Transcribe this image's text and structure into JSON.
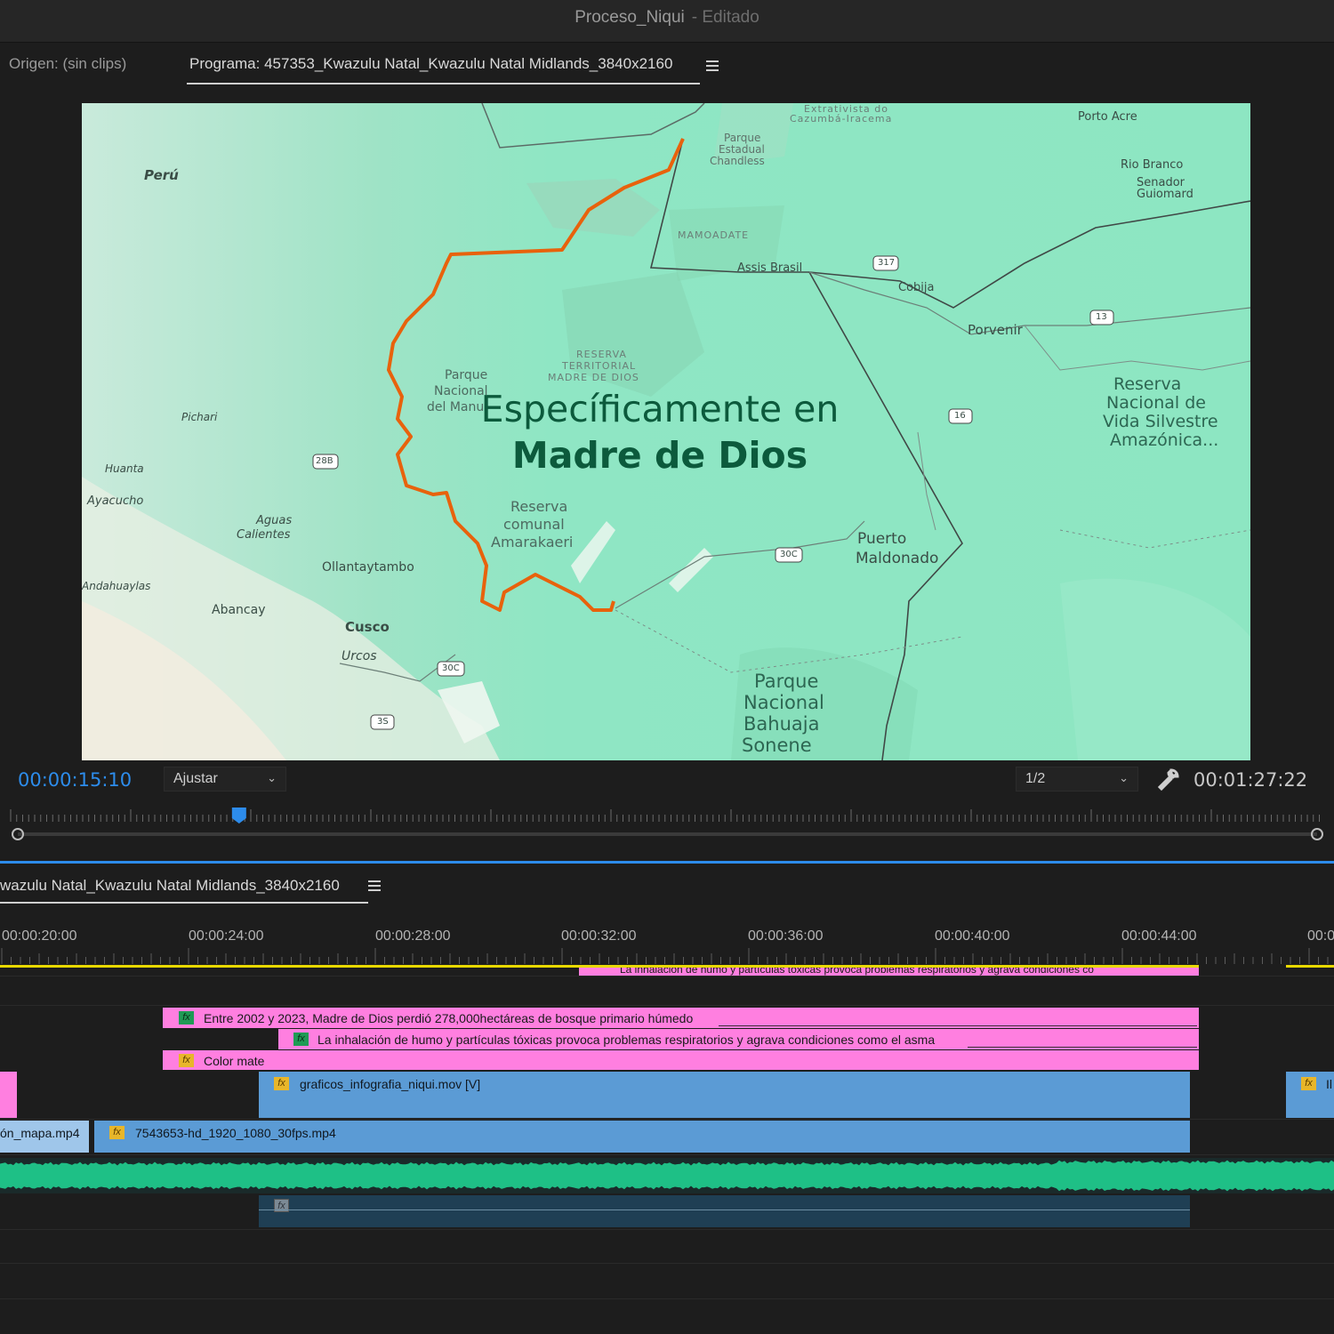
{
  "window": {
    "title": "Proceso_Niqui",
    "status": "- Editado"
  },
  "monitor": {
    "source_tab": "Origen: (sin clips)",
    "program_tab": "Programa: 457353_Kwazulu Natal_Kwazulu Natal Midlands_3840x2160",
    "menu_icon": "hamburger-menu-icon"
  },
  "viewer": {
    "overlay_line1": "Específicamente en",
    "overlay_line2": "Madre de Dios",
    "map_labels": {
      "peru": "Perú",
      "porto_acre": "Porto Acre",
      "rio_branco": "Rio Branco",
      "senador": "Senador",
      "guiomard": "Guiomard",
      "parque_estadual": "Parque",
      "estadual": "Estadual",
      "chandless": "Chandless",
      "mamoadate": "MAMOADATE",
      "assis_brasil": "Assis Brasil",
      "cobija": "Cobija",
      "porvenir": "Porvenir",
      "reserva_nacional": "Reserva",
      "nacional_de": "Nacional de",
      "vida_silvestre": "Vida Silvestre",
      "amazonica": "Amazónica...",
      "reserva_territorial": "RESERVA",
      "territorial": "TERRITORIAL",
      "madre_de_dios": "MADRE DE DIOS",
      "parque_manu": "Parque",
      "nacional_manu": "Nacional",
      "del_manu": "del Manu",
      "reserva_comunal": "Reserva",
      "comunal": "comunal",
      "amarakaeri": "Amarakaeri",
      "puerto": "Puerto",
      "maldonado": "Maldonado",
      "parque_bahuaja": "Parque",
      "nacional_bahuaja": "Nacional",
      "bahuaja": "Bahuaja",
      "sonene": "Sonene",
      "ollantaytambo": "Ollantaytambo",
      "cusco": "Cusco",
      "urcos": "Urcos",
      "abancay": "Abancay",
      "aguas": "Aguas",
      "calientes": "Calientes",
      "ayacucho": "Ayacucho",
      "huanta": "Huanta",
      "andahuaylas": "Andahuaylas",
      "pichari": "Pichari",
      "extrativista": "Extrativista do",
      "cazumba": "Cazumbá-Iracema",
      "route_317": "317",
      "route_13": "13",
      "route_16": "16",
      "route_30c": "30C",
      "route_28b": "28B",
      "route_3s": "3S"
    }
  },
  "controls": {
    "current_time": "00:00:15:10",
    "fit_label": "Ajustar",
    "resolution": "1/2",
    "duration": "00:01:27:22",
    "wrench_icon": "wrench-icon",
    "playhead_fraction": 0.174
  },
  "timeline": {
    "sequence_tab": "wazulu Natal_Kwazulu Natal Midlands_3840x2160",
    "ticks": [
      "00:00:20:00",
      "00:00:24:00",
      "00:00:28:00",
      "00:00:32:00",
      "00:00:36:00",
      "00:00:40:00",
      "00:00:44:00",
      "00:0"
    ],
    "clips": {
      "text1": "Entre 2002 y 2023, Madre de Dios perdió 278,000hectáreas de bosque primario húmedo",
      "text2": "La inhalación de humo y partículas tóxicas provoca problemas respiratorios y agrava condiciones como el asma",
      "top_clipped": "La inhalación de humo y partículas tóxicas provoca problemas respiratorios y agrava condiciones co",
      "color_mate": "Color mate",
      "graphics": "graficos_infografia_niqui.mov [V]",
      "graphics_right": "Il",
      "video_left": "ón_mapa.mp4",
      "video_main": "7543653-hd_1920_1080_30fps.mp4",
      "fx": "fx"
    }
  },
  "colors": {
    "accent_blue": "#2d8ceb",
    "graphic_clip_pink": "#ff7fe0",
    "video_clip_blue": "#5b9bd5",
    "audio_waveform": "#1fbf86",
    "route_orange": "#e8620c",
    "map_green": "#8fe6c4"
  }
}
